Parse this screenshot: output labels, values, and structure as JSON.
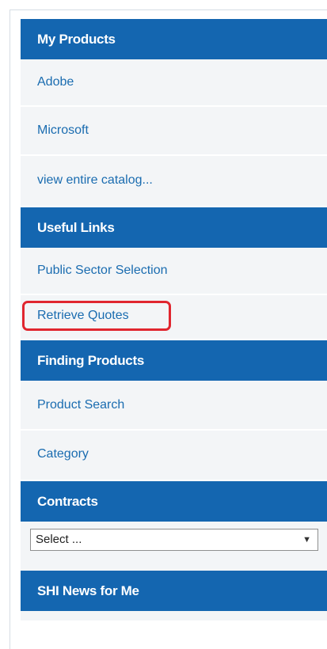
{
  "sidebar": {
    "my_products": {
      "header": "My Products",
      "links": [
        "Adobe",
        "Microsoft",
        "view entire catalog..."
      ]
    },
    "useful_links": {
      "header": "Useful Links",
      "links": [
        "Public Sector Selection",
        "Retrieve Quotes"
      ]
    },
    "finding_products": {
      "header": "Finding Products",
      "links": [
        "Product Search",
        "Category"
      ]
    },
    "contracts": {
      "header": "Contracts",
      "select_value": "Select ...",
      "select_arrow": "▼"
    },
    "news": {
      "header": "SHI News for Me"
    }
  },
  "highlight": {
    "target": "Retrieve Quotes",
    "color": "#e0262f"
  },
  "colors": {
    "header_bg": "#1466b0",
    "link_text": "#1a6cb0",
    "row_bg": "#f3f5f7"
  }
}
